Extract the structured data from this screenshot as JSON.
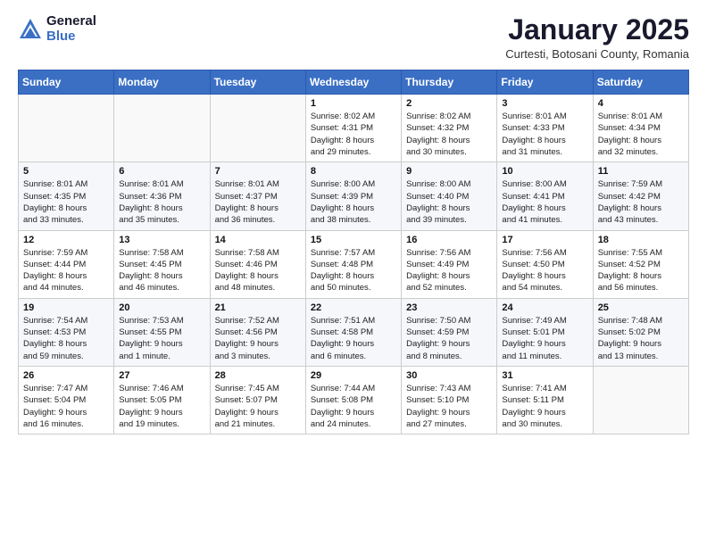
{
  "logo": {
    "general": "General",
    "blue": "Blue"
  },
  "title": "January 2025",
  "subtitle": "Curtesti, Botosani County, Romania",
  "weekdays": [
    "Sunday",
    "Monday",
    "Tuesday",
    "Wednesday",
    "Thursday",
    "Friday",
    "Saturday"
  ],
  "weeks": [
    [
      {
        "day": "",
        "info": ""
      },
      {
        "day": "",
        "info": ""
      },
      {
        "day": "",
        "info": ""
      },
      {
        "day": "1",
        "info": "Sunrise: 8:02 AM\nSunset: 4:31 PM\nDaylight: 8 hours\nand 29 minutes."
      },
      {
        "day": "2",
        "info": "Sunrise: 8:02 AM\nSunset: 4:32 PM\nDaylight: 8 hours\nand 30 minutes."
      },
      {
        "day": "3",
        "info": "Sunrise: 8:01 AM\nSunset: 4:33 PM\nDaylight: 8 hours\nand 31 minutes."
      },
      {
        "day": "4",
        "info": "Sunrise: 8:01 AM\nSunset: 4:34 PM\nDaylight: 8 hours\nand 32 minutes."
      }
    ],
    [
      {
        "day": "5",
        "info": "Sunrise: 8:01 AM\nSunset: 4:35 PM\nDaylight: 8 hours\nand 33 minutes."
      },
      {
        "day": "6",
        "info": "Sunrise: 8:01 AM\nSunset: 4:36 PM\nDaylight: 8 hours\nand 35 minutes."
      },
      {
        "day": "7",
        "info": "Sunrise: 8:01 AM\nSunset: 4:37 PM\nDaylight: 8 hours\nand 36 minutes."
      },
      {
        "day": "8",
        "info": "Sunrise: 8:00 AM\nSunset: 4:39 PM\nDaylight: 8 hours\nand 38 minutes."
      },
      {
        "day": "9",
        "info": "Sunrise: 8:00 AM\nSunset: 4:40 PM\nDaylight: 8 hours\nand 39 minutes."
      },
      {
        "day": "10",
        "info": "Sunrise: 8:00 AM\nSunset: 4:41 PM\nDaylight: 8 hours\nand 41 minutes."
      },
      {
        "day": "11",
        "info": "Sunrise: 7:59 AM\nSunset: 4:42 PM\nDaylight: 8 hours\nand 43 minutes."
      }
    ],
    [
      {
        "day": "12",
        "info": "Sunrise: 7:59 AM\nSunset: 4:44 PM\nDaylight: 8 hours\nand 44 minutes."
      },
      {
        "day": "13",
        "info": "Sunrise: 7:58 AM\nSunset: 4:45 PM\nDaylight: 8 hours\nand 46 minutes."
      },
      {
        "day": "14",
        "info": "Sunrise: 7:58 AM\nSunset: 4:46 PM\nDaylight: 8 hours\nand 48 minutes."
      },
      {
        "day": "15",
        "info": "Sunrise: 7:57 AM\nSunset: 4:48 PM\nDaylight: 8 hours\nand 50 minutes."
      },
      {
        "day": "16",
        "info": "Sunrise: 7:56 AM\nSunset: 4:49 PM\nDaylight: 8 hours\nand 52 minutes."
      },
      {
        "day": "17",
        "info": "Sunrise: 7:56 AM\nSunset: 4:50 PM\nDaylight: 8 hours\nand 54 minutes."
      },
      {
        "day": "18",
        "info": "Sunrise: 7:55 AM\nSunset: 4:52 PM\nDaylight: 8 hours\nand 56 minutes."
      }
    ],
    [
      {
        "day": "19",
        "info": "Sunrise: 7:54 AM\nSunset: 4:53 PM\nDaylight: 8 hours\nand 59 minutes."
      },
      {
        "day": "20",
        "info": "Sunrise: 7:53 AM\nSunset: 4:55 PM\nDaylight: 9 hours\nand 1 minute."
      },
      {
        "day": "21",
        "info": "Sunrise: 7:52 AM\nSunset: 4:56 PM\nDaylight: 9 hours\nand 3 minutes."
      },
      {
        "day": "22",
        "info": "Sunrise: 7:51 AM\nSunset: 4:58 PM\nDaylight: 9 hours\nand 6 minutes."
      },
      {
        "day": "23",
        "info": "Sunrise: 7:50 AM\nSunset: 4:59 PM\nDaylight: 9 hours\nand 8 minutes."
      },
      {
        "day": "24",
        "info": "Sunrise: 7:49 AM\nSunset: 5:01 PM\nDaylight: 9 hours\nand 11 minutes."
      },
      {
        "day": "25",
        "info": "Sunrise: 7:48 AM\nSunset: 5:02 PM\nDaylight: 9 hours\nand 13 minutes."
      }
    ],
    [
      {
        "day": "26",
        "info": "Sunrise: 7:47 AM\nSunset: 5:04 PM\nDaylight: 9 hours\nand 16 minutes."
      },
      {
        "day": "27",
        "info": "Sunrise: 7:46 AM\nSunset: 5:05 PM\nDaylight: 9 hours\nand 19 minutes."
      },
      {
        "day": "28",
        "info": "Sunrise: 7:45 AM\nSunset: 5:07 PM\nDaylight: 9 hours\nand 21 minutes."
      },
      {
        "day": "29",
        "info": "Sunrise: 7:44 AM\nSunset: 5:08 PM\nDaylight: 9 hours\nand 24 minutes."
      },
      {
        "day": "30",
        "info": "Sunrise: 7:43 AM\nSunset: 5:10 PM\nDaylight: 9 hours\nand 27 minutes."
      },
      {
        "day": "31",
        "info": "Sunrise: 7:41 AM\nSunset: 5:11 PM\nDaylight: 9 hours\nand 30 minutes."
      },
      {
        "day": "",
        "info": ""
      }
    ]
  ]
}
